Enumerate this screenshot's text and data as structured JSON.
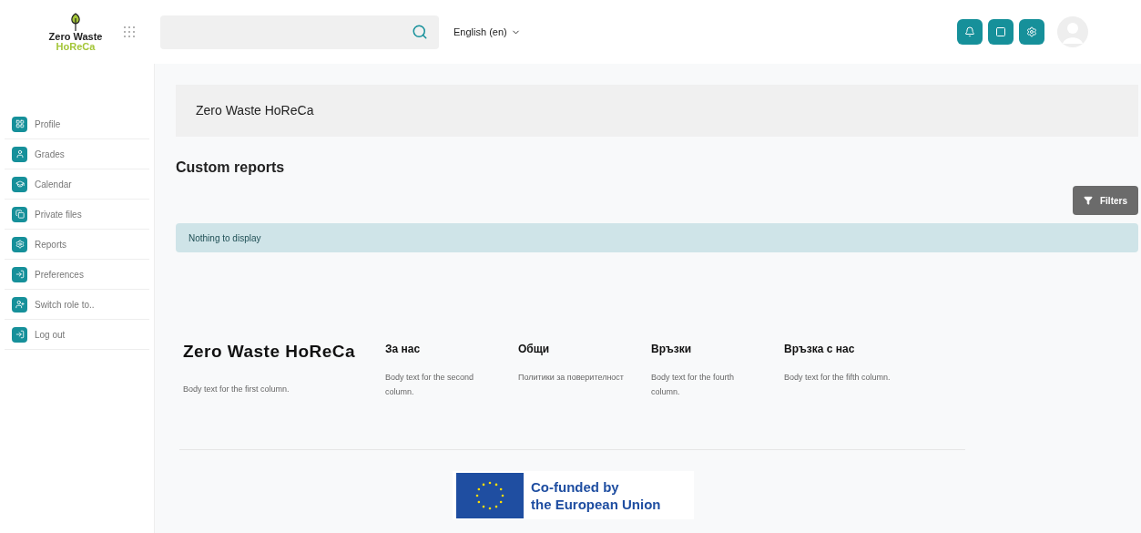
{
  "header": {
    "logo": {
      "line1": "Zero Waste",
      "line2": "HoReCa"
    },
    "language": "English (en)"
  },
  "sidebar": {
    "items": [
      {
        "label": "Profile",
        "kind": "grid"
      },
      {
        "label": "Grades",
        "kind": "user"
      },
      {
        "label": "Calendar",
        "kind": "cap"
      },
      {
        "label": "Private files",
        "kind": "files"
      },
      {
        "label": "Reports",
        "kind": "gear"
      },
      {
        "label": "Preferences",
        "kind": "login"
      },
      {
        "label": "Switch role to..",
        "kind": "useradd"
      },
      {
        "label": "Log out",
        "kind": "login"
      }
    ]
  },
  "course_banner": "Zero Waste HoReCa",
  "page_title": "Custom reports",
  "filters_button": "Filters",
  "alert": "Nothing to display",
  "footer": {
    "columns": [
      {
        "title": "Zero Waste HoReCa",
        "body": "Body text for the first column.",
        "kind": "brand"
      },
      {
        "title": "За нас",
        "body": "Body text for the second column.",
        "kind": "plain"
      },
      {
        "title": "Общи",
        "body": "Политики за поверителност",
        "kind": "plain"
      },
      {
        "title": "Връзки",
        "body": "Body text for the fourth column.",
        "kind": "plain"
      },
      {
        "title": "Връзка с нас",
        "body": "Body text for the fifth column.",
        "kind": "plain"
      }
    ],
    "eu_logo": {
      "line1": "Co-funded by",
      "line2": "the European Union"
    }
  }
}
